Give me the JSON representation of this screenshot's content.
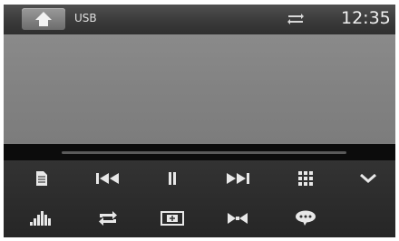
{
  "status_bar": {
    "source": "USB",
    "time": "12:35"
  },
  "icons": {
    "home": "home-icon",
    "repeat_status": "repeat-icon",
    "file_list": "file-list-icon",
    "previous": "skip-previous-icon",
    "pause": "pause-icon",
    "next": "skip-next-icon",
    "menu": "grid-menu-icon",
    "collapse": "chevron-down-icon",
    "equalizer": "equalizer-icon",
    "repeat": "repeat-icon",
    "aspect": "aspect-ratio-icon",
    "zoom": "zoom-icon",
    "subtitle": "subtitle-icon"
  },
  "colors": {
    "icon": "#e8e8e8",
    "accent": "#cfcfcf",
    "background": "#2a2a2a"
  }
}
